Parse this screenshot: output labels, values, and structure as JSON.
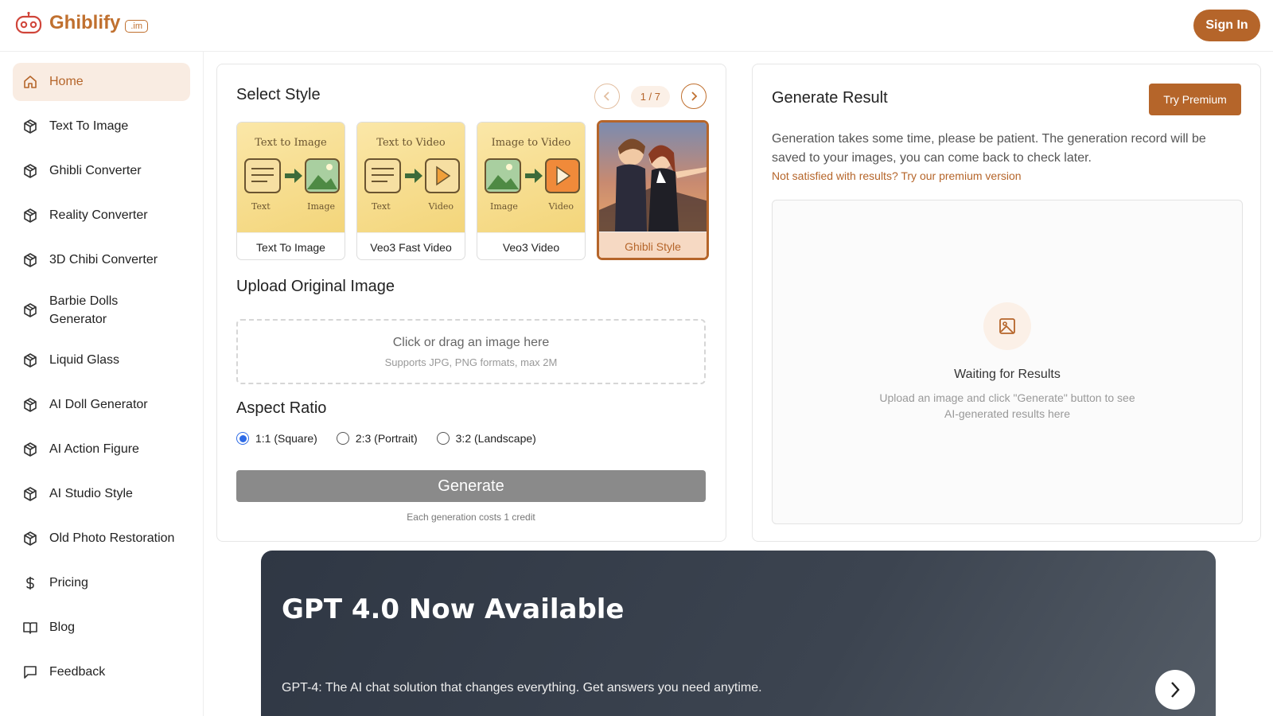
{
  "header": {
    "brand": "Ghiblify",
    "brand_badge": ".im",
    "signin_label": "Sign In"
  },
  "sidebar": {
    "items": [
      {
        "label": "Home",
        "icon": "home-icon",
        "active": true
      },
      {
        "label": "Text To Image",
        "icon": "cube-icon"
      },
      {
        "label": "Ghibli Converter",
        "icon": "cube-icon"
      },
      {
        "label": "Reality Converter",
        "icon": "cube-icon"
      },
      {
        "label": "3D Chibi Converter",
        "icon": "cube-icon"
      },
      {
        "label": "Barbie Dolls Generator",
        "icon": "cube-icon"
      },
      {
        "label": "Liquid Glass",
        "icon": "cube-icon"
      },
      {
        "label": "AI Doll Generator",
        "icon": "cube-icon"
      },
      {
        "label": "AI Action Figure",
        "icon": "cube-icon"
      },
      {
        "label": "AI Studio Style",
        "icon": "cube-icon"
      },
      {
        "label": "Old Photo Restoration",
        "icon": "cube-icon"
      },
      {
        "label": "Pricing",
        "icon": "dollar-icon"
      },
      {
        "label": "Blog",
        "icon": "book-icon"
      },
      {
        "label": "Feedback",
        "icon": "message-icon"
      }
    ]
  },
  "select_style": {
    "title": "Select Style",
    "page_indicator": "1 / 7",
    "styles": [
      {
        "label": "Text To Image",
        "heading": "Text to Image",
        "left": "Text",
        "right": "Image"
      },
      {
        "label": "Veo3 Fast Video",
        "heading": "Text to Video",
        "left": "Text",
        "right": "Video"
      },
      {
        "label": "Veo3 Video",
        "heading": "Image to Video",
        "left": "Image",
        "right": "Video"
      },
      {
        "label": "Ghibli Style",
        "selected": true
      }
    ]
  },
  "upload": {
    "title": "Upload Original Image",
    "prompt": "Click or drag an image here",
    "hint": "Supports JPG, PNG formats, max 2M"
  },
  "aspect_ratio": {
    "title": "Aspect Ratio",
    "options": [
      "1:1 (Square)",
      "2:3 (Portrait)",
      "3:2 (Landscape)"
    ],
    "selected": "1:1 (Square)"
  },
  "generate": {
    "label": "Generate",
    "note": "Each generation costs 1 credit"
  },
  "result": {
    "title": "Generate Result",
    "premium_label": "Try Premium",
    "description": "Generation takes some time, please be patient. The generation record will be saved to your images, you can come back to check later.",
    "premium_note": "Not satisfied with results? Try our premium version",
    "waiting_title": "Waiting for Results",
    "waiting_sub": "Upload an image and click \"Generate\" button to see AI-generated results here"
  },
  "banner": {
    "title": "GPT 4.0 Now Available",
    "subtitle": "GPT-4: The AI chat solution that changes everything. Get answers you need anytime."
  },
  "colors": {
    "accent": "#b5652a",
    "accent_light": "#f9ece2",
    "banner_dark": "#2f3744"
  }
}
